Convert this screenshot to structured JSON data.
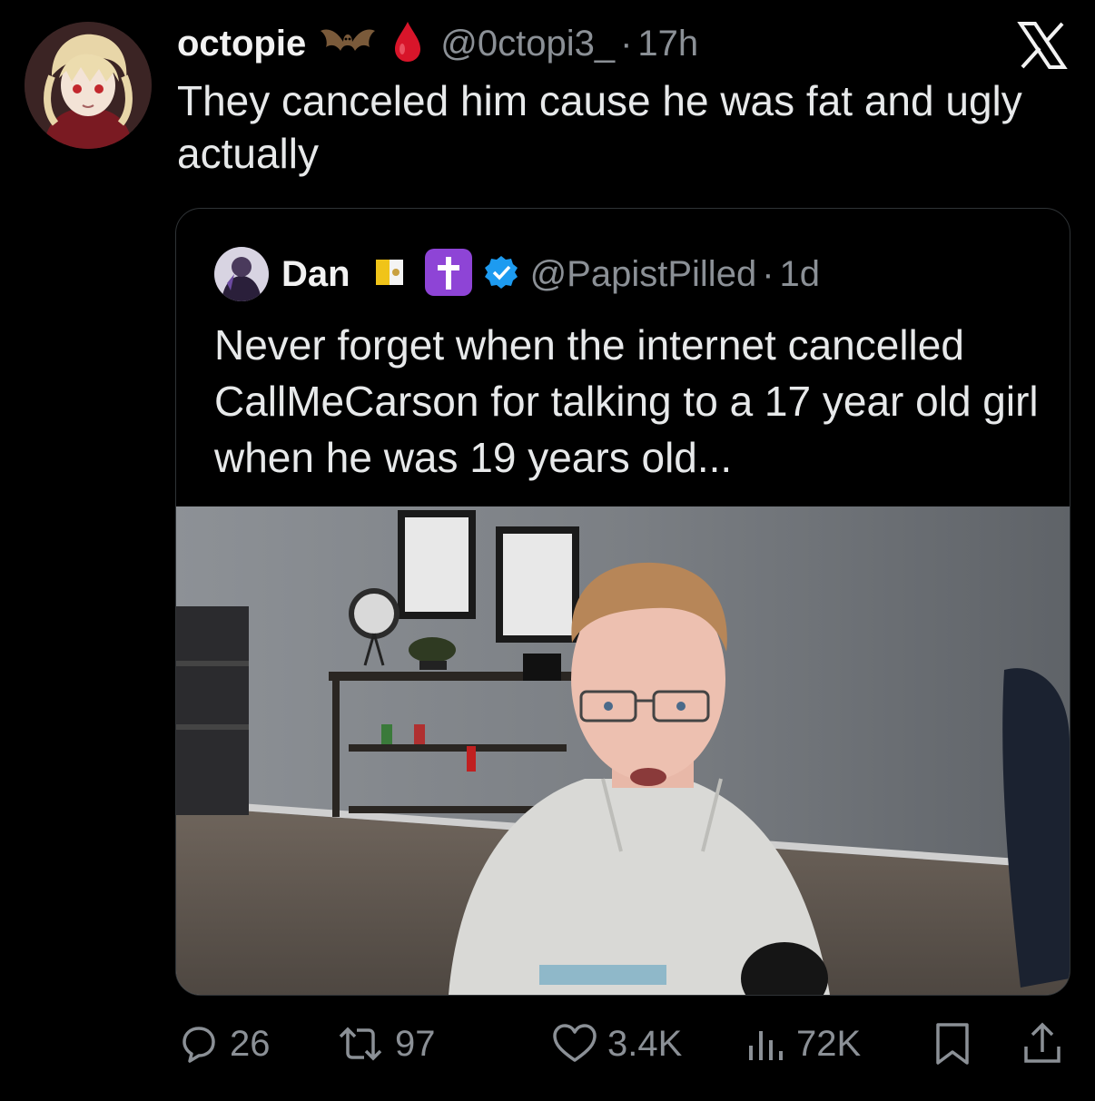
{
  "tweet": {
    "author_name": "octopie",
    "author_emoji_1": "bat-emoji",
    "author_emoji_2": "drop-of-blood-emoji",
    "handle": "@0ctopi3_",
    "separator": "·",
    "time": "17h",
    "text": "They canceled him cause he was fat and ugly actually"
  },
  "quoted": {
    "author_name": "Dan",
    "badges": [
      "vatican-flag-emoji",
      "latin-cross-emoji",
      "verified-badge-icon"
    ],
    "handle": "@PapistPilled",
    "separator": "·",
    "time": "1d",
    "text": "Never forget when the internet cancelled CallMeCarson for talking to a 17 year old girl when he was 19 years old..."
  },
  "actions": {
    "replies": "26",
    "reposts": "97",
    "likes": "3.4K",
    "views": "72K"
  },
  "colors": {
    "background": "#000000",
    "text": "#e7e9ea",
    "muted": "#8b9096",
    "border": "#2f3336",
    "verified": "#1d9bf0",
    "cross_badge": "#8e44d6"
  }
}
